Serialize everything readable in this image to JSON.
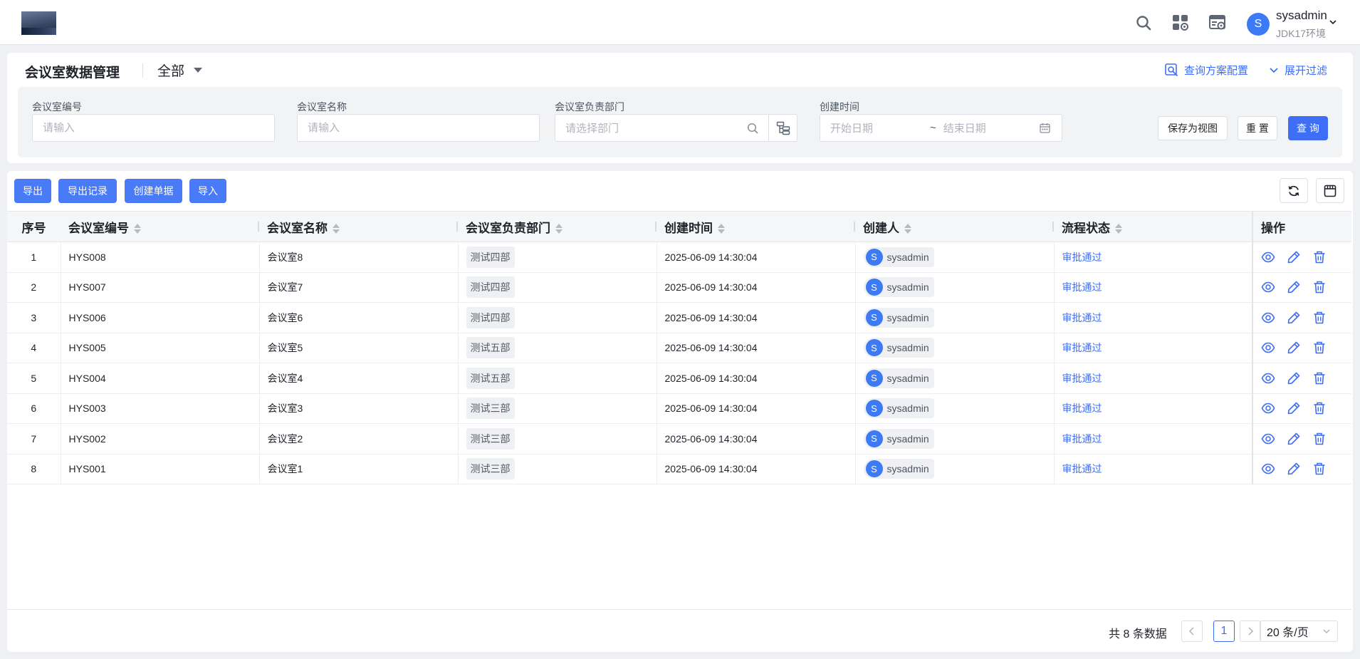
{
  "header": {
    "user_initial": "S",
    "user_name": "sysadmin",
    "env": "JDK17环境"
  },
  "page": {
    "title": "会议室数据管理",
    "view": "全部",
    "query_config": "查询方案配置",
    "expand_filter": "展开过滤"
  },
  "filters": {
    "code_label": "会议室编号",
    "code_placeholder": "请输入",
    "name_label": "会议室名称",
    "name_placeholder": "请输入",
    "dept_label": "会议室负责部门",
    "dept_placeholder": "请选择部门",
    "time_label": "创建时间",
    "start_placeholder": "开始日期",
    "range_sep": "~",
    "end_placeholder": "结束日期",
    "save_view": "保存为视图",
    "reset": "重 置",
    "query": "查 询"
  },
  "toolbar": {
    "export": "导出",
    "export_log": "导出记录",
    "create": "创建单据",
    "import": "导入"
  },
  "table": {
    "columns": [
      "序号",
      "会议室编号",
      "会议室名称",
      "会议室负责部门",
      "创建时间",
      "创建人",
      "流程状态",
      "操作"
    ],
    "rows": [
      {
        "seq": "1",
        "code": "HYS008",
        "name": "会议室8",
        "dept": "测试四部",
        "time": "2025-06-09 14:30:04",
        "creator_initial": "S",
        "creator": "sysadmin",
        "status": "审批通过"
      },
      {
        "seq": "2",
        "code": "HYS007",
        "name": "会议室7",
        "dept": "测试四部",
        "time": "2025-06-09 14:30:04",
        "creator_initial": "S",
        "creator": "sysadmin",
        "status": "审批通过"
      },
      {
        "seq": "3",
        "code": "HYS006",
        "name": "会议室6",
        "dept": "测试四部",
        "time": "2025-06-09 14:30:04",
        "creator_initial": "S",
        "creator": "sysadmin",
        "status": "审批通过"
      },
      {
        "seq": "4",
        "code": "HYS005",
        "name": "会议室5",
        "dept": "测试五部",
        "time": "2025-06-09 14:30:04",
        "creator_initial": "S",
        "creator": "sysadmin",
        "status": "审批通过"
      },
      {
        "seq": "5",
        "code": "HYS004",
        "name": "会议室4",
        "dept": "测试五部",
        "time": "2025-06-09 14:30:04",
        "creator_initial": "S",
        "creator": "sysadmin",
        "status": "审批通过"
      },
      {
        "seq": "6",
        "code": "HYS003",
        "name": "会议室3",
        "dept": "测试三部",
        "time": "2025-06-09 14:30:04",
        "creator_initial": "S",
        "creator": "sysadmin",
        "status": "审批通过"
      },
      {
        "seq": "7",
        "code": "HYS002",
        "name": "会议室2",
        "dept": "测试三部",
        "time": "2025-06-09 14:30:04",
        "creator_initial": "S",
        "creator": "sysadmin",
        "status": "审批通过"
      },
      {
        "seq": "8",
        "code": "HYS001",
        "name": "会议室1",
        "dept": "测试三部",
        "time": "2025-06-09 14:30:04",
        "creator_initial": "S",
        "creator": "sysadmin",
        "status": "审批通过"
      }
    ]
  },
  "pagination": {
    "total": "共 8 条数据",
    "current": "1",
    "page_size": "20 条/页"
  },
  "colors": {
    "primary": "#3d6ef5",
    "avatar": "#3d7af5"
  },
  "icons": [
    "search-icon",
    "app-grid-icon",
    "settings-panel-icon",
    "chevron-down-icon",
    "query-config-icon",
    "org-tree-icon",
    "calendar-icon",
    "refresh-icon",
    "column-settings-icon",
    "view-icon",
    "edit-icon",
    "delete-icon"
  ]
}
